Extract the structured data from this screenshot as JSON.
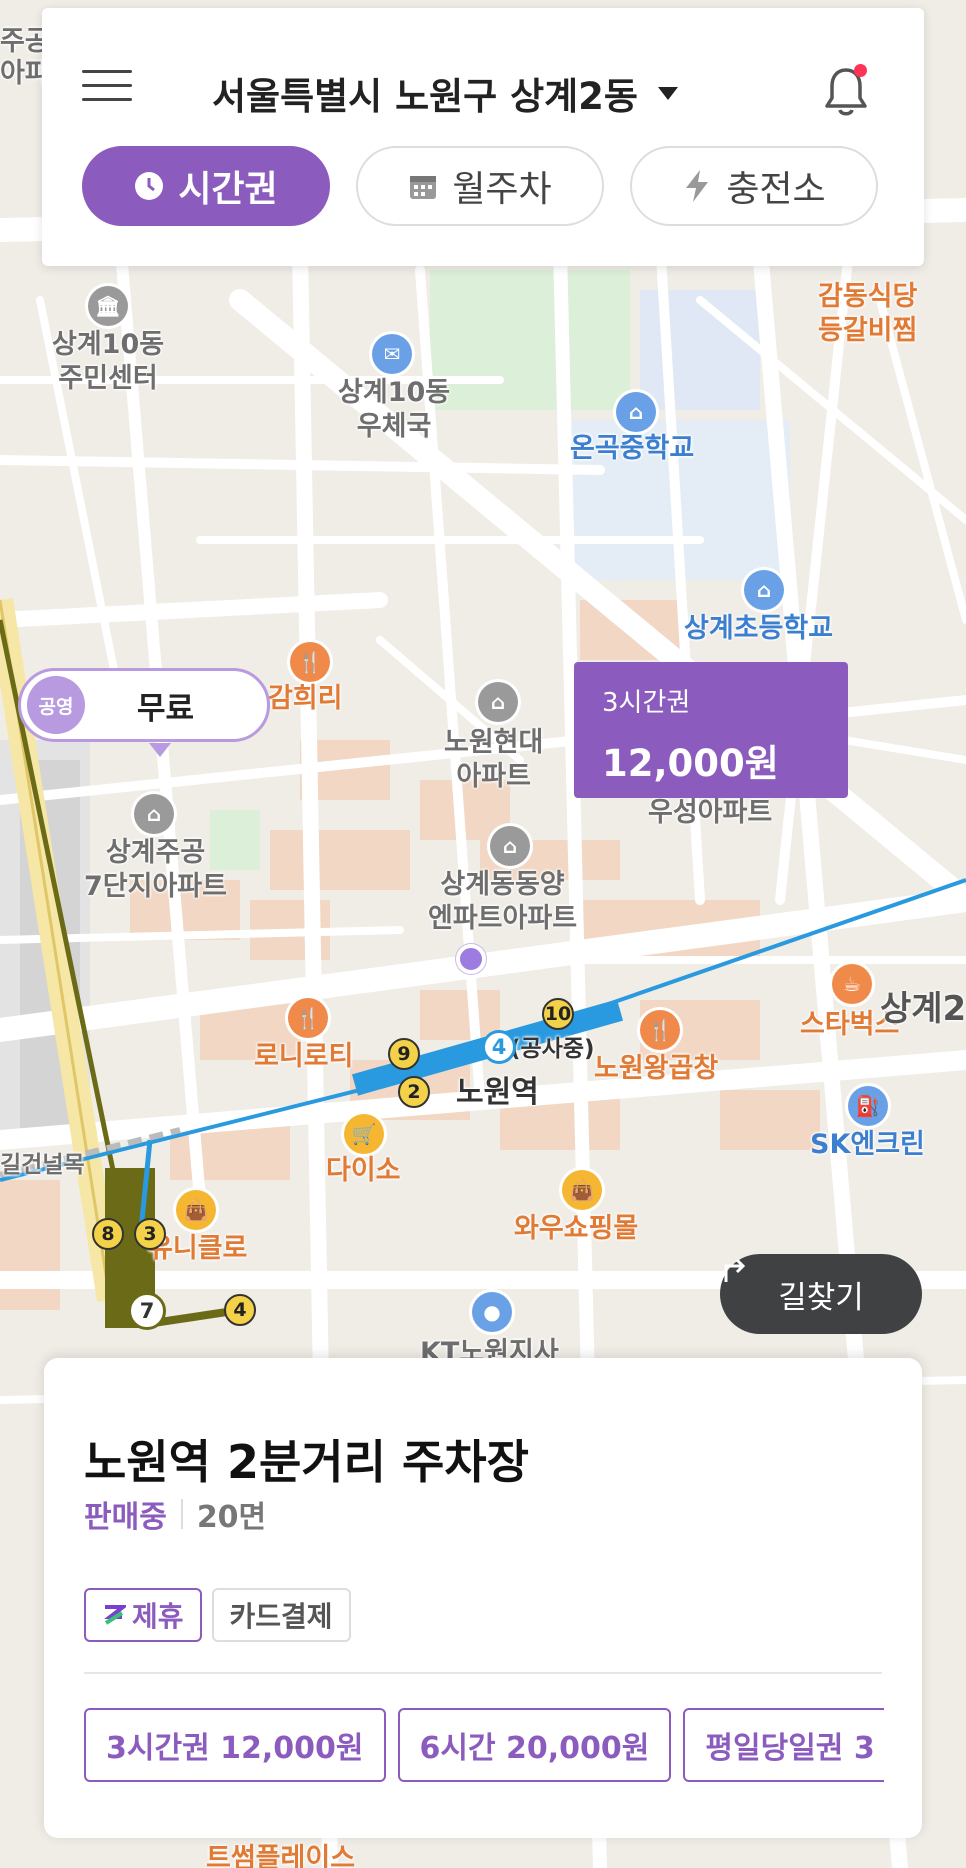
{
  "header": {
    "location": "서울특별시 노원구 상계2동",
    "tabs": [
      {
        "label": "시간권",
        "icon": "clock-icon",
        "active": true
      },
      {
        "label": "월주차",
        "icon": "calendar-icon",
        "active": false
      },
      {
        "label": "충전소",
        "icon": "bolt-icon",
        "active": false
      }
    ]
  },
  "colors": {
    "accent": "#8b5cbd",
    "accent_light": "#b79ae0",
    "notification_dot": "#ff3355",
    "subway_line4": "#2a9ae0",
    "subway_line7": "#6b6b17"
  },
  "map": {
    "pois": {
      "p1": "상계10동\n주민센터",
      "p2": "상계10동\n우체국",
      "p3": "온곡중학교",
      "p4": "감동식당\n등갈비찜",
      "p5": "상계초등학교",
      "p6": "감희리",
      "p7": "노원현대\n아파트",
      "p8": "우성아파트",
      "p9": "상계주공\n7단지아파트",
      "p10": "상계동동양\n엔파트아파트",
      "p11": "스타벅스",
      "p12": "상계2",
      "p13": "로니로티",
      "p14": "(공사중)",
      "p15": "노원왕곱창",
      "p16": "노원역",
      "p17": "SK엔크린",
      "p18": "다이소",
      "p19": "길건널목",
      "p20": "와우쇼핑몰",
      "p21": "유니클로",
      "p22": "KT노원지사",
      "p23": "주공\n아파",
      "p24": "트썸플레이스"
    },
    "exit_numbers": [
      "10",
      "9",
      "2",
      "8",
      "3",
      "4"
    ],
    "line_badges": {
      "line4": "4",
      "line7": "7"
    },
    "free_marker": {
      "badge": "공영",
      "label": "무료"
    },
    "price_marker": {
      "title": "3시간권",
      "price": "12,000원"
    },
    "directions_label": "길찾기"
  },
  "lot": {
    "name": "노원역 2분거리 주차장",
    "status": "판매중",
    "spaces": "20면",
    "tags": [
      {
        "label": "제휴",
        "icon": "partner-z-icon"
      },
      {
        "label": "카드결제"
      }
    ],
    "tickets": [
      "3시간권 12,000원",
      "6시간 20,000원",
      "평일당일권 3"
    ]
  }
}
